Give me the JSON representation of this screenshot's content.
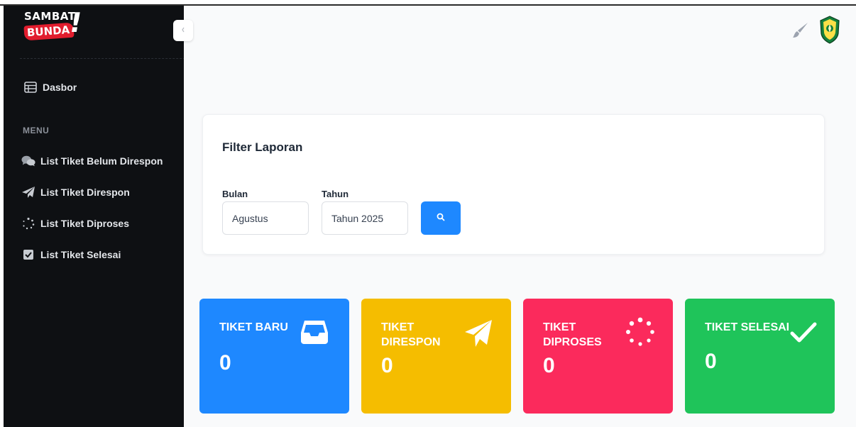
{
  "brand": {
    "line1": "SAMBAT",
    "line2": "BUNDA",
    "mark": "!"
  },
  "sidebar": {
    "dashboard_label": "Dasbor",
    "menu_heading": "MENU",
    "items": [
      {
        "label": "List Tiket Belum Direspon",
        "icon": "chat-bubbles-icon"
      },
      {
        "label": "List Tiket Direspon",
        "icon": "paper-plane-icon"
      },
      {
        "label": "List Tiket Diproses",
        "icon": "spinner-icon"
      },
      {
        "label": "List Tiket Selesai",
        "icon": "checkbox-icon"
      }
    ]
  },
  "filter": {
    "title": "Filter Laporan",
    "month_label": "Bulan",
    "month_value": "Agustus",
    "year_label": "Tahun",
    "year_value": "Tahun 2025"
  },
  "stats": [
    {
      "title": "TIKET BARU",
      "value": "0",
      "color": "#1e88ff",
      "icon": "inbox-icon"
    },
    {
      "title": "TIKET DIRESPON",
      "value": "0",
      "color": "#f5bd00",
      "icon": "paper-plane-icon"
    },
    {
      "title": "TIKET DIPROSES",
      "value": "0",
      "color": "#fb2a5c",
      "icon": "spinner-icon"
    },
    {
      "title": "TIKET SELESAI",
      "value": "0",
      "color": "#1fc45a",
      "icon": "check-icon"
    }
  ]
}
